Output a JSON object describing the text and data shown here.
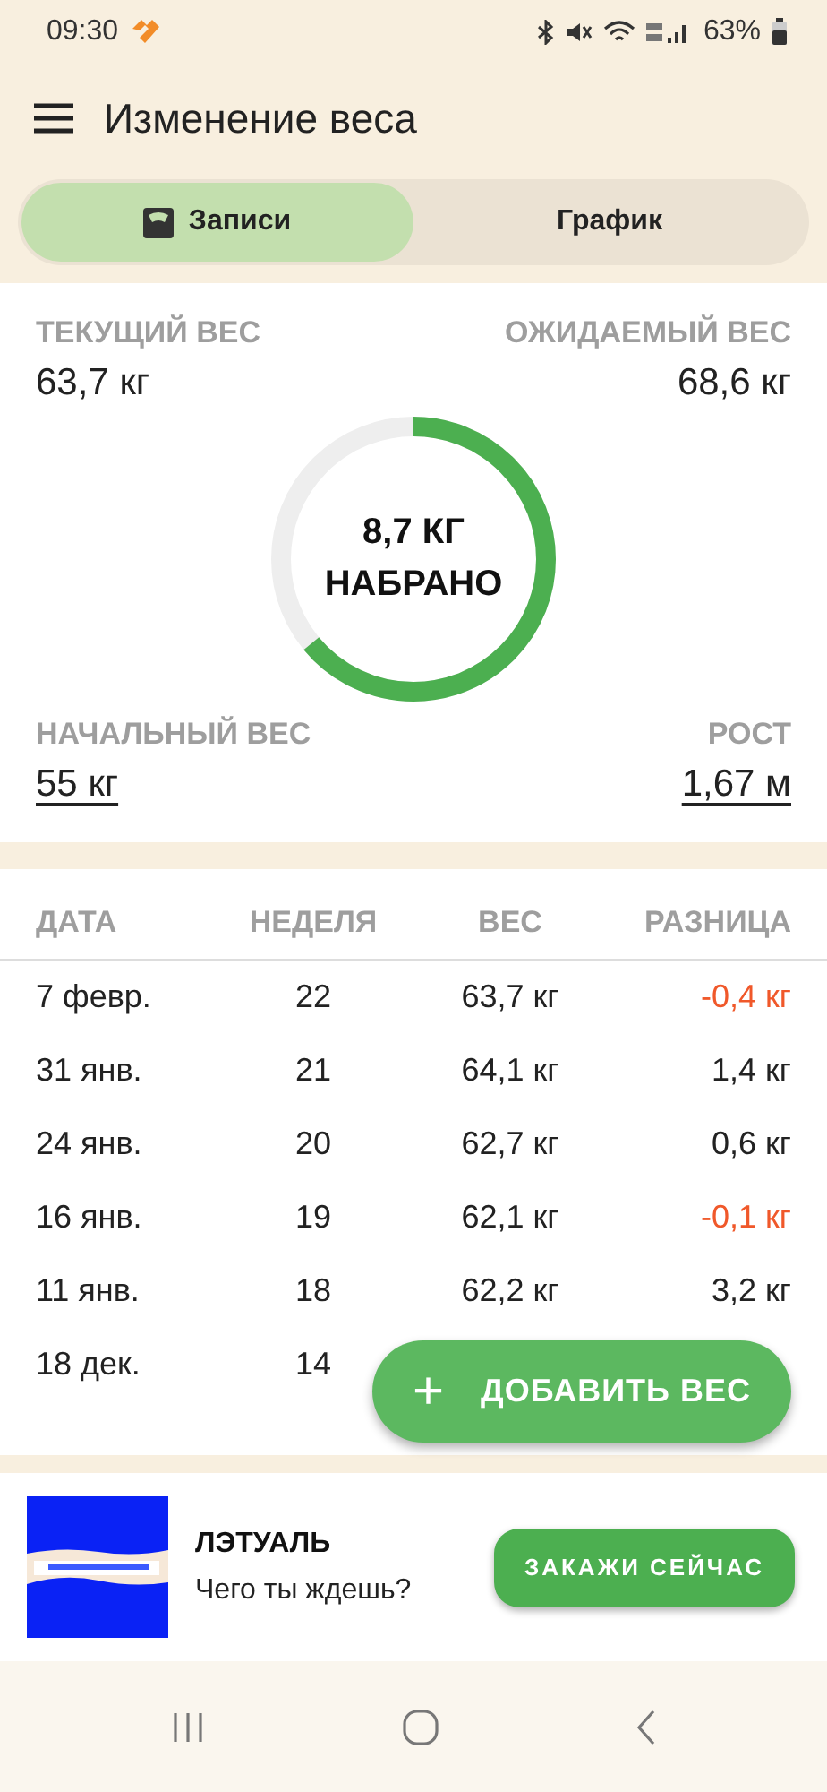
{
  "status_bar": {
    "time": "09:30",
    "battery": "63%"
  },
  "app_bar": {
    "title": "Изменение веса"
  },
  "tabs": [
    {
      "label": "Записи",
      "selected": true
    },
    {
      "label": "График",
      "selected": false
    }
  ],
  "summary": {
    "current": {
      "label": "ТЕКУЩИЙ ВЕС",
      "value": "63,7 кг"
    },
    "target": {
      "label": "ОЖИДАЕМЫЙ ВЕС",
      "value": "68,6 кг"
    },
    "progress": {
      "level": 0.64,
      "amount": "8,7 КГ",
      "caption": "НАБРАНО"
    },
    "start": {
      "label": "НАЧАЛЬНЫЙ ВЕС",
      "value": "55 кг"
    },
    "height": {
      "label": "РОСТ",
      "value": "1,67 м"
    }
  },
  "table": {
    "columns": [
      "ДАТА",
      "НЕДЕЛЯ",
      "ВЕС",
      "РАЗНИЦА"
    ],
    "rows": [
      {
        "date": "7 февр.",
        "week": "22",
        "weight": "63,7 кг",
        "diff": "-0,4 кг",
        "negative": true
      },
      {
        "date": "31 янв.",
        "week": "21",
        "weight": "64,1 кг",
        "diff": "1,4 кг",
        "negative": false
      },
      {
        "date": "24 янв.",
        "week": "20",
        "weight": "62,7 кг",
        "diff": "0,6 кг",
        "negative": false
      },
      {
        "date": "16 янв.",
        "week": "19",
        "weight": "62,1 кг",
        "diff": "-0,1 кг",
        "negative": true
      },
      {
        "date": "11 янв.",
        "week": "18",
        "weight": "62,2 кг",
        "diff": "3,2 кг",
        "negative": false
      },
      {
        "date": "18 дек.",
        "week": "14"
      }
    ]
  },
  "fab": {
    "icon": "+",
    "label": "ДОБАВИТЬ ВЕС"
  },
  "ad": {
    "kind": "picture",
    "title": "ЛЭТУАЛЬ",
    "text": "Чего ты ждешь?",
    "button": "ЗАКАЖИ СЕЙЧАС"
  }
}
